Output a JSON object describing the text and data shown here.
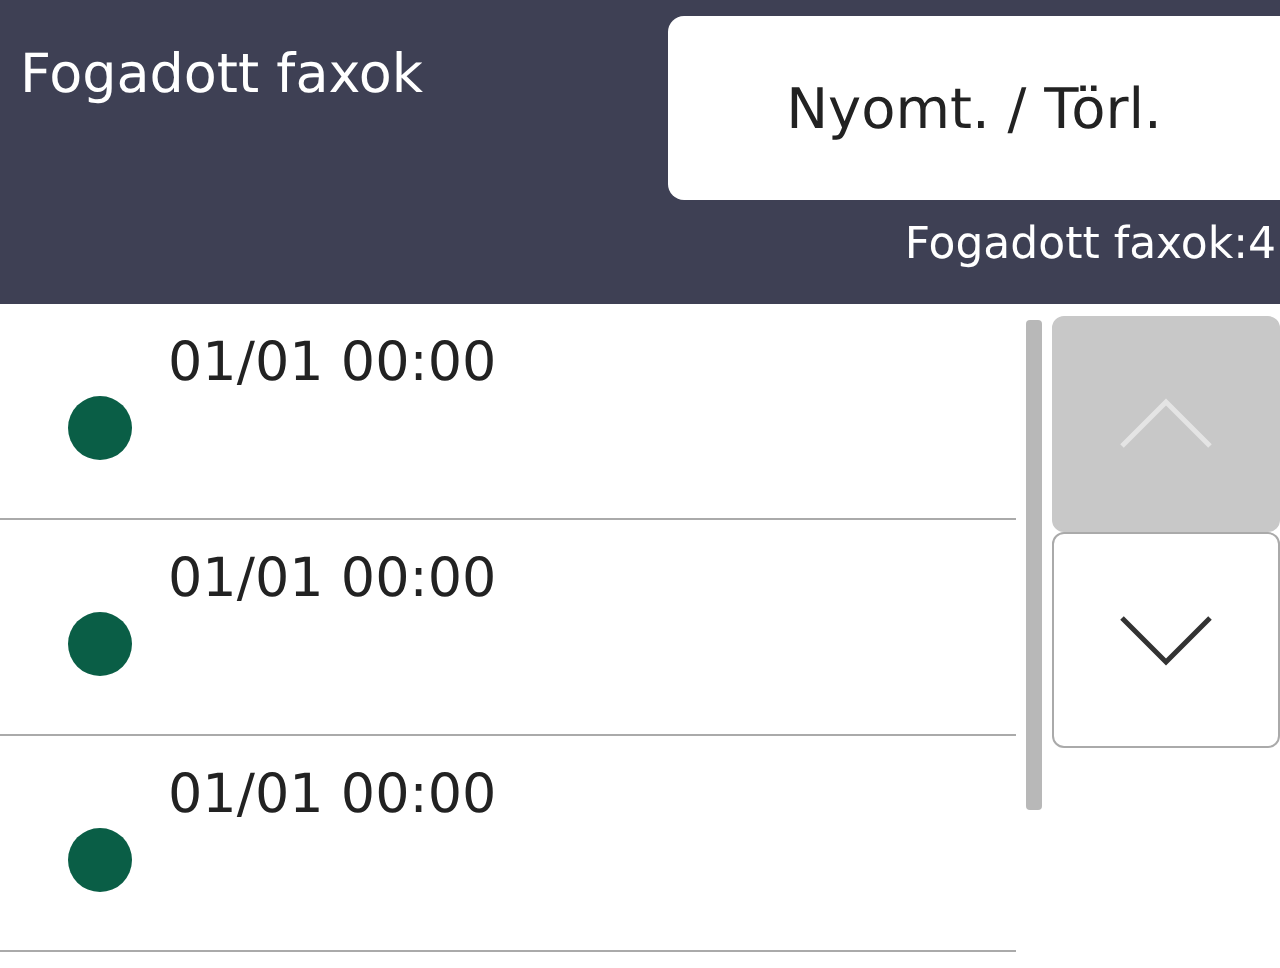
{
  "header": {
    "title": "Fogadott faxok",
    "action_button": "Nyomt. / Törl."
  },
  "count_label": "Fogadott faxok:4",
  "faxes": [
    {
      "time": "01/01 00:00",
      "color": "#0a5e46"
    },
    {
      "time": "01/01 00:00",
      "color": "#0a5e46"
    },
    {
      "time": "01/01 00:00",
      "color": "#0a5e46"
    }
  ],
  "scroll_buttons": [
    {
      "kind": "up",
      "disabled": true
    },
    {
      "kind": "down",
      "disabled": false
    }
  ]
}
